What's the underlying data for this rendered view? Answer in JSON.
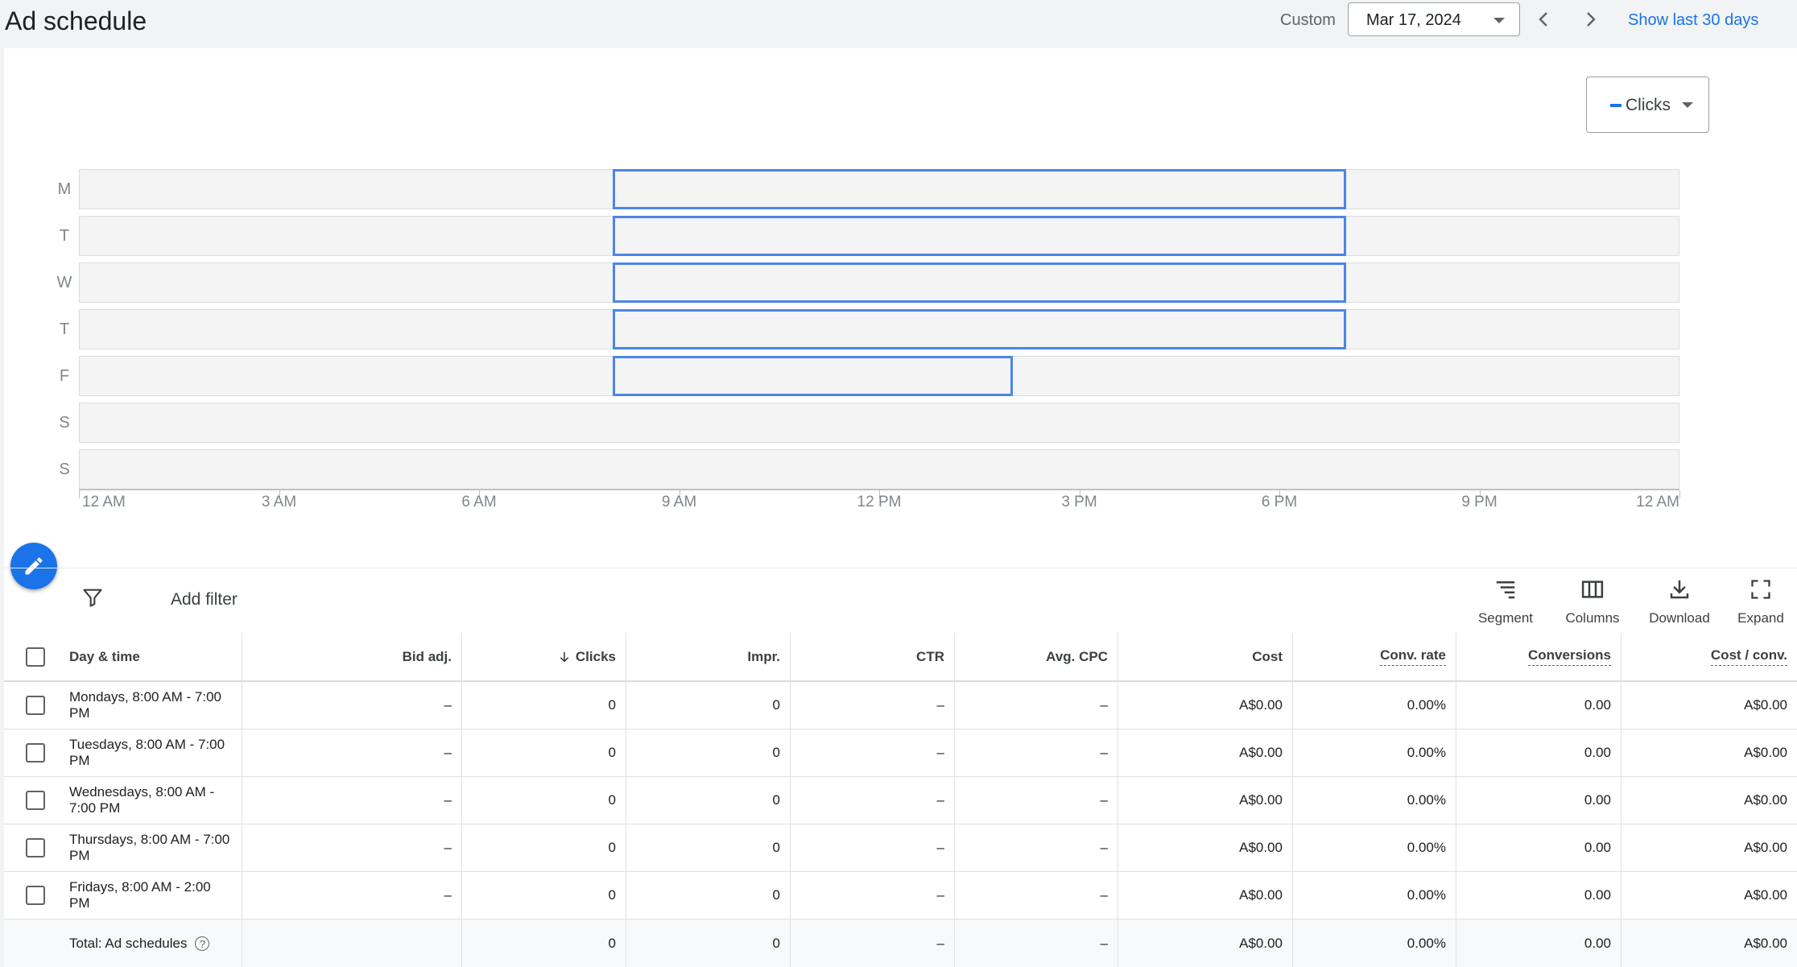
{
  "header": {
    "title": "Ad schedule",
    "date_range_label": "Custom",
    "date_value": "Mar 17, 2024",
    "show_last_link": "Show last 30 days"
  },
  "chart_controls": {
    "metric_label": "Clicks",
    "metric_color": "#1a73e8"
  },
  "schedule_chart": {
    "days": [
      "M",
      "T",
      "W",
      "T",
      "F",
      "S",
      "S"
    ],
    "x_ticks": [
      "12 AM",
      "3 AM",
      "6 AM",
      "9 AM",
      "12 PM",
      "3 PM",
      "6 PM",
      "9 PM",
      "12 AM"
    ],
    "x_range_hours": [
      0,
      24
    ],
    "blocks": [
      {
        "day": 0,
        "start": 8,
        "end": 19
      },
      {
        "day": 1,
        "start": 8,
        "end": 19
      },
      {
        "day": 2,
        "start": 8,
        "end": 19
      },
      {
        "day": 3,
        "start": 8,
        "end": 19
      },
      {
        "day": 4,
        "start": 8,
        "end": 14
      }
    ],
    "block_color": "#4a86e8"
  },
  "filter_bar": {
    "add_filter": "Add filter",
    "tools": [
      "Segment",
      "Columns",
      "Download",
      "Expand"
    ]
  },
  "table": {
    "columns": [
      "Day & time",
      "Bid adj.",
      "Clicks",
      "Impr.",
      "CTR",
      "Avg. CPC",
      "Cost",
      "Conv. rate",
      "Conversions",
      "Cost / conv."
    ],
    "rows": [
      [
        "Mondays, 8:00 AM - 7:00 PM",
        "–",
        "0",
        "0",
        "–",
        "–",
        "A$0.00",
        "0.00%",
        "0.00",
        "A$0.00"
      ],
      [
        "Tuesdays, 8:00 AM - 7:00 PM",
        "–",
        "0",
        "0",
        "–",
        "–",
        "A$0.00",
        "0.00%",
        "0.00",
        "A$0.00"
      ],
      [
        "Wednesdays, 8:00 AM - 7:00 PM",
        "–",
        "0",
        "0",
        "–",
        "–",
        "A$0.00",
        "0.00%",
        "0.00",
        "A$0.00"
      ],
      [
        "Thursdays, 8:00 AM - 7:00 PM",
        "–",
        "0",
        "0",
        "–",
        "–",
        "A$0.00",
        "0.00%",
        "0.00",
        "A$0.00"
      ],
      [
        "Fridays, 8:00 AM - 2:00 PM",
        "–",
        "0",
        "0",
        "–",
        "–",
        "A$0.00",
        "0.00%",
        "0.00",
        "A$0.00"
      ]
    ],
    "total": [
      "Total: Ad schedules",
      "",
      "0",
      "0",
      "–",
      "–",
      "A$0.00",
      "0.00%",
      "0.00",
      "A$0.00"
    ]
  }
}
